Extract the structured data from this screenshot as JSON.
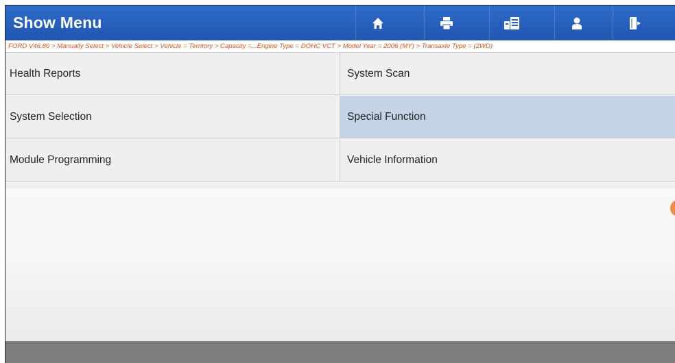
{
  "header": {
    "title": "Show Menu",
    "buttons": [
      {
        "icon": "home-icon",
        "label": "Home"
      },
      {
        "icon": "print-icon",
        "label": "Print"
      },
      {
        "icon": "report-icon",
        "label": "Report"
      },
      {
        "icon": "user-icon",
        "label": "User"
      },
      {
        "icon": "exit-icon",
        "label": "Exit"
      }
    ]
  },
  "breadcrumb": "FORD V46.80 > Manually Select > Vehicle Select > Vehicle = Territory > Capacity =...Engine Type = DOHC VCT > Model Year = 2006 (MY) > Transaxle Type = (2WD)",
  "menu": {
    "items": [
      {
        "label": "Health Reports",
        "selected": false
      },
      {
        "label": "System Scan",
        "selected": false
      },
      {
        "label": "System Selection",
        "selected": false
      },
      {
        "label": "Special Function",
        "selected": true
      },
      {
        "label": "Module Programming",
        "selected": false
      },
      {
        "label": "Vehicle Information",
        "selected": false
      }
    ]
  },
  "colors": {
    "titlebar": "#2a63c2",
    "breadcrumb_text": "#e0551c",
    "selected_cell": "#c5d3e6",
    "float_handle": "#f08a3c"
  }
}
